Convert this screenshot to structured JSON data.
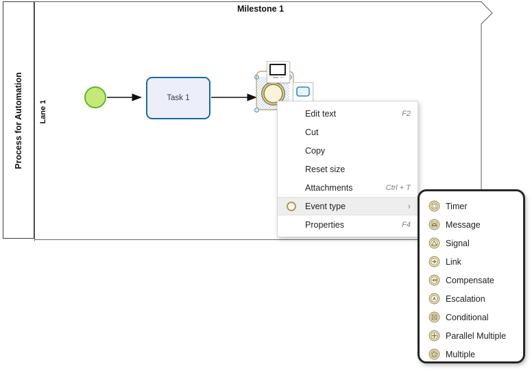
{
  "diagram": {
    "pool_label": "Process for Automation",
    "lane_label": "Lane 1",
    "milestone_label": "Milestone 1",
    "start_event_name": "start-event",
    "task_label": "Task 1",
    "event_name": "intermediate-event"
  },
  "floating_toolbar": {
    "annotation_icon": "text-annotation-icon",
    "task_icon": "task-shape-icon"
  },
  "context_menu": {
    "items": [
      {
        "label": "Edit text",
        "shortcut": "F2",
        "icon": "",
        "arrow": "",
        "highlight": false
      },
      {
        "label": "Cut",
        "shortcut": "",
        "icon": "",
        "arrow": "",
        "highlight": false
      },
      {
        "label": "Copy",
        "shortcut": "",
        "icon": "",
        "arrow": "",
        "highlight": false
      },
      {
        "label": "Reset size",
        "shortcut": "",
        "icon": "",
        "arrow": "",
        "highlight": false
      },
      {
        "label": "Attachments",
        "shortcut": "Ctrl + T",
        "icon": "",
        "arrow": "",
        "highlight": false
      },
      {
        "label": "Event type",
        "shortcut": "",
        "icon": "event-ring-icon",
        "arrow": "›",
        "highlight": true
      },
      {
        "label": "Properties",
        "shortcut": "F4",
        "icon": "",
        "arrow": "",
        "highlight": false
      }
    ]
  },
  "submenu": {
    "title": "Event type",
    "items": [
      {
        "label": "Timer",
        "icon": "timer-event-icon"
      },
      {
        "label": "Message",
        "icon": "message-event-icon"
      },
      {
        "label": "Signal",
        "icon": "signal-event-icon"
      },
      {
        "label": "Link",
        "icon": "link-event-icon"
      },
      {
        "label": "Compensate",
        "icon": "compensate-event-icon"
      },
      {
        "label": "Escalation",
        "icon": "escalation-event-icon"
      },
      {
        "label": "Conditional",
        "icon": "conditional-event-icon"
      },
      {
        "label": "Parallel Multiple",
        "icon": "parallel-multiple-event-icon"
      },
      {
        "label": "Multiple",
        "icon": "multiple-event-icon"
      }
    ]
  },
  "colors": {
    "start_event_fill": "#c6e87a",
    "start_event_stroke": "#62b524",
    "task_fill": "#eceef9",
    "task_stroke": "#18699e",
    "event_stroke": "#9a8e53",
    "event_fill": "#f7f3d8",
    "milestone_stroke": "#5a5a5a",
    "submenu_border": "#262626",
    "menu_highlight": "#eeeeee"
  }
}
